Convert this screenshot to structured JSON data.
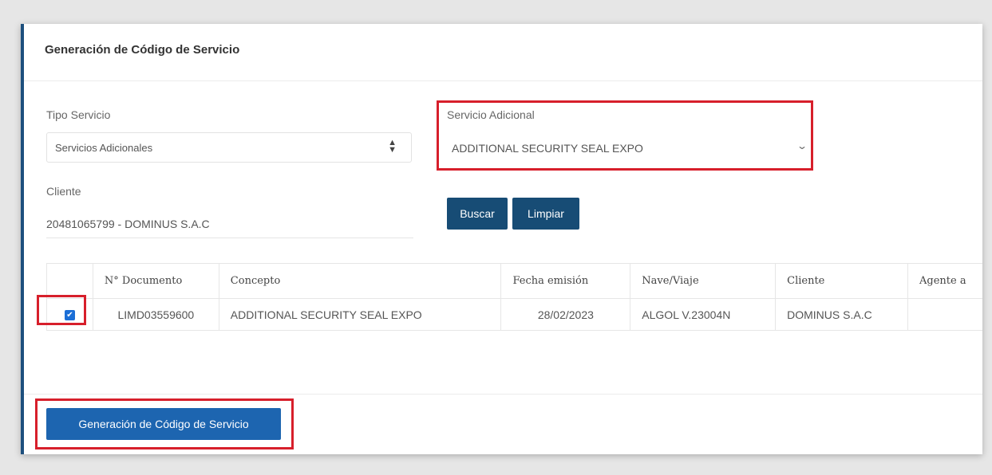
{
  "header": {
    "title": "Generación de Código de Servicio"
  },
  "tipo_servicio": {
    "label": "Tipo Servicio",
    "value": "Servicios Adicionales"
  },
  "servicio_adicional": {
    "label": "Servicio Adicional",
    "value": "ADDITIONAL SECURITY SEAL EXPO"
  },
  "cliente": {
    "label": "Cliente",
    "value": "20481065799 - DOMINUS S.A.C"
  },
  "actions": {
    "buscar": "Buscar",
    "limpiar": "Limpiar"
  },
  "table": {
    "headers": [
      "N° Documento",
      "Concepto",
      "Fecha emisión",
      "Nave/Viaje",
      "Cliente",
      "Agente a"
    ],
    "rows": [
      {
        "checked": true,
        "cells": [
          "LIMD03559600",
          "ADDITIONAL SECURITY SEAL EXPO",
          "28/02/2023",
          "ALGOL V.23004N",
          "DOMINUS S.A.C",
          ""
        ]
      }
    ]
  },
  "footer": {
    "generate_button": "Generación de Código de Servicio"
  },
  "colors": {
    "primary": "#174c75",
    "button_blue": "#1d65b0",
    "highlight_red": "#d71f2b",
    "checkbox_blue": "#1b6ed6"
  },
  "icons": {
    "select_arrows": "sort-icon",
    "dropdown": "chevron-down-icon",
    "checkbox": "check-icon"
  }
}
